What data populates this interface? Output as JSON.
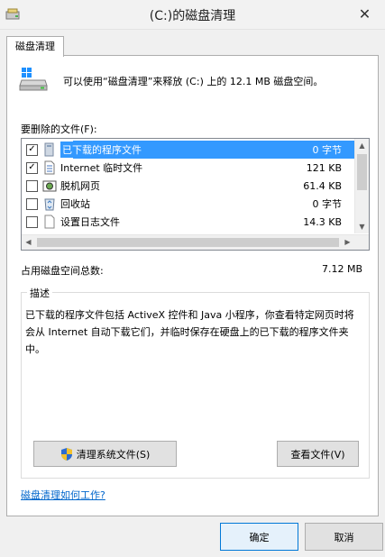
{
  "window": {
    "title": "(C:)的磁盘清理",
    "close_glyph": "✕"
  },
  "tab": {
    "label": "磁盘清理"
  },
  "summary": {
    "text": "可以使用“磁盘清理”来释放  (C:) 上的 12.1 MB 磁盘空间。"
  },
  "files": {
    "label": "要删除的文件(F):",
    "items": [
      {
        "name": "已下载的程序文件",
        "size": "0 字节",
        "checked": true,
        "selected": true,
        "icon": "folder-icon"
      },
      {
        "name": "Internet 临时文件",
        "size": "121 KB",
        "checked": true,
        "selected": false,
        "icon": "document-icon"
      },
      {
        "name": "脱机网页",
        "size": "61.4 KB",
        "checked": false,
        "selected": false,
        "icon": "offline-webpage-icon"
      },
      {
        "name": "回收站",
        "size": "0 字节",
        "checked": false,
        "selected": false,
        "icon": "recycle-bin-icon"
      },
      {
        "name": "设置日志文件",
        "size": "14.3 KB",
        "checked": false,
        "selected": false,
        "icon": "log-file-icon"
      }
    ]
  },
  "total": {
    "label": "占用磁盘空间总数:",
    "value": "7.12 MB"
  },
  "description": {
    "title": "描述",
    "text": "已下载的程序文件包括 ActiveX 控件和 Java 小程序，你查看特定网页时将会从 Internet 自动下载它们，并临时保存在硬盘上的已下载的程序文件夹中。"
  },
  "buttons": {
    "clean_system": "清理系统文件(S)",
    "view_files": "查看文件(V)",
    "ok": "确定",
    "cancel": "取消"
  },
  "help_link": "磁盘清理如何工作?",
  "colors": {
    "selection": "#3399ff",
    "link": "#0066cc",
    "background": "#f0f0f0"
  }
}
